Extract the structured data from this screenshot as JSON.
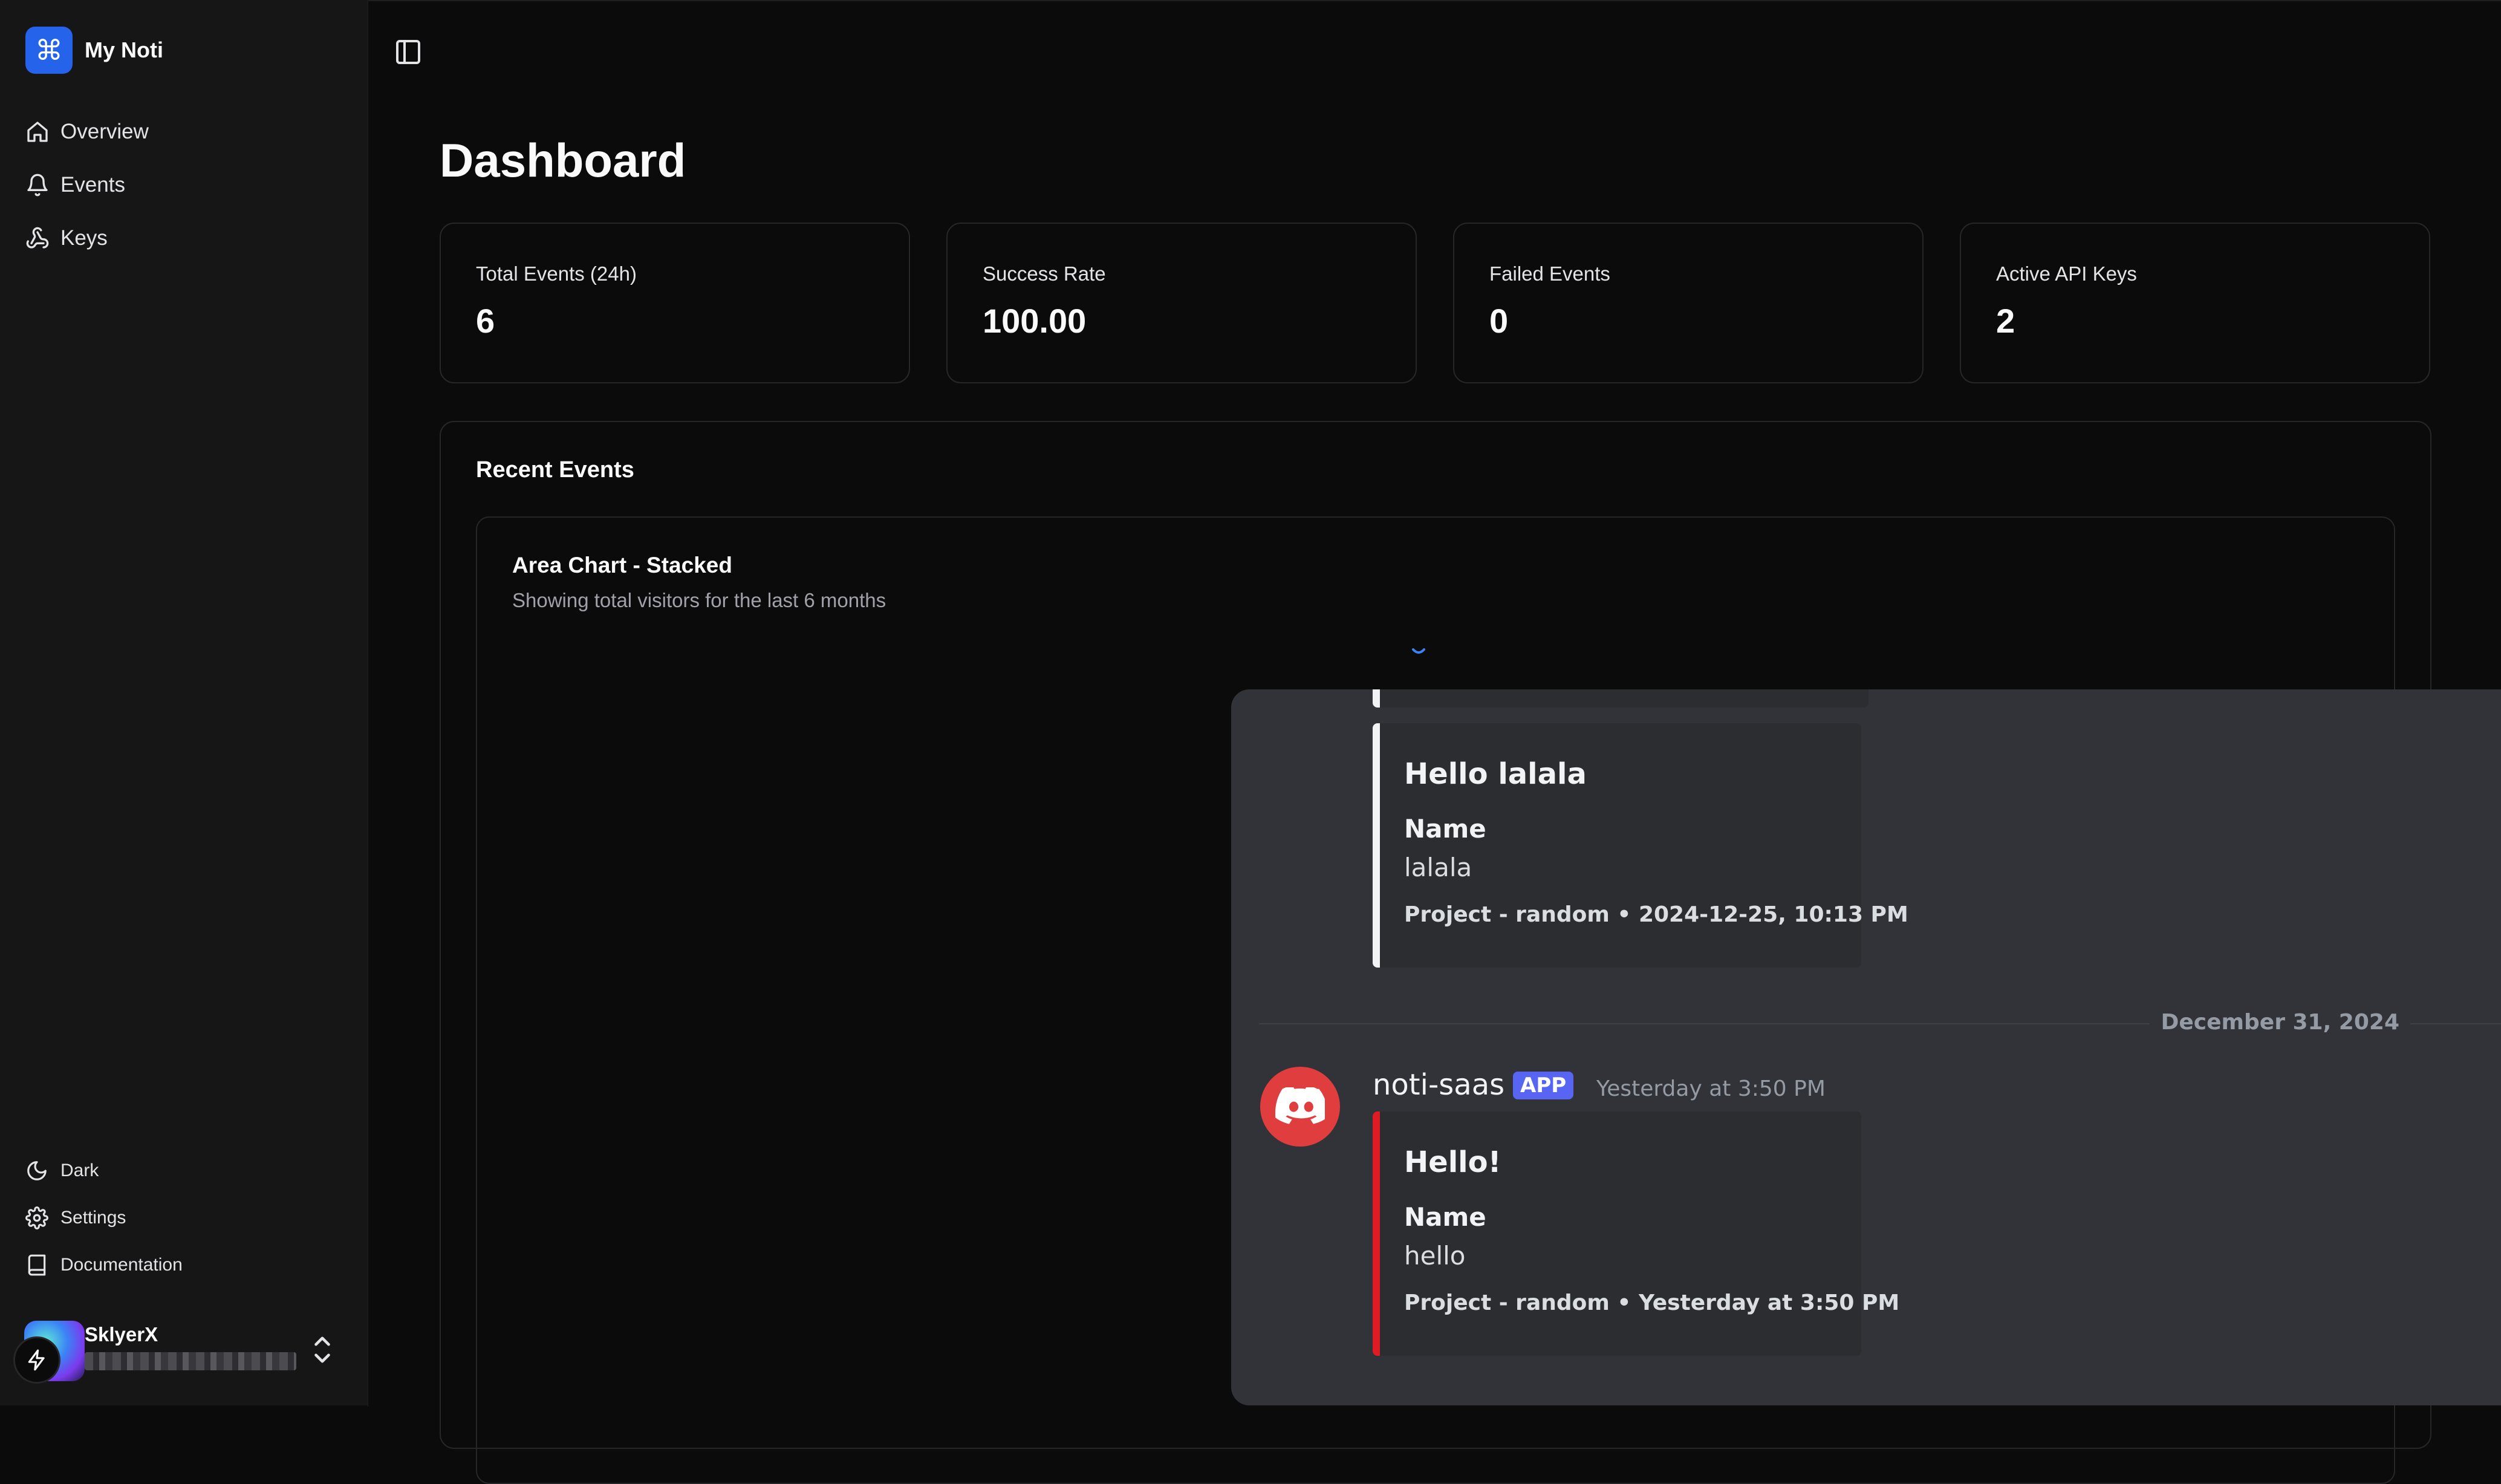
{
  "sidebar": {
    "brand": {
      "name": "My Noti",
      "logo_glyph": "⌘",
      "logo_color": "#2563eb"
    },
    "nav": [
      {
        "label": "Overview",
        "icon": "home-icon"
      },
      {
        "label": "Events",
        "icon": "bell-icon"
      },
      {
        "label": "Keys",
        "icon": "webhook-icon"
      }
    ],
    "footer": [
      {
        "label": "Dark",
        "icon": "moon-icon"
      },
      {
        "label": "Settings",
        "icon": "gear-icon"
      },
      {
        "label": "Documentation",
        "icon": "book-icon"
      }
    ],
    "user": {
      "name": "SklyerX",
      "email": "██████ ████████"
    }
  },
  "main": {
    "title": "Dashboard",
    "stats": [
      {
        "label": "Total Events (24h)",
        "value": "6"
      },
      {
        "label": "Success Rate",
        "value": "100.00"
      },
      {
        "label": "Failed Events",
        "value": "0"
      },
      {
        "label": "Active API Keys",
        "value": "2"
      }
    ],
    "recent_events": {
      "title": "Recent Events",
      "chart": {
        "title": "Area Chart - Stacked",
        "subtitle": "Showing total visitors for the last 6 months"
      }
    }
  },
  "discord": {
    "embed_1": {
      "title": "Hello lalala",
      "field_name": "Name",
      "field_value": "lalala",
      "footer": "Project - random • 2024-12-25, 10:13 PM",
      "accent": "#f2f3f5"
    },
    "divider_date": "December 31, 2024",
    "message": {
      "author": "noti-saas",
      "badge": "APP",
      "timestamp": "Yesterday at 3:50 PM",
      "embed": {
        "title": "Hello!",
        "field_name": "Name",
        "field_value": "hello",
        "footer": "Project - random • Yesterday at 3:50 PM",
        "accent": "#e01b24"
      }
    }
  }
}
